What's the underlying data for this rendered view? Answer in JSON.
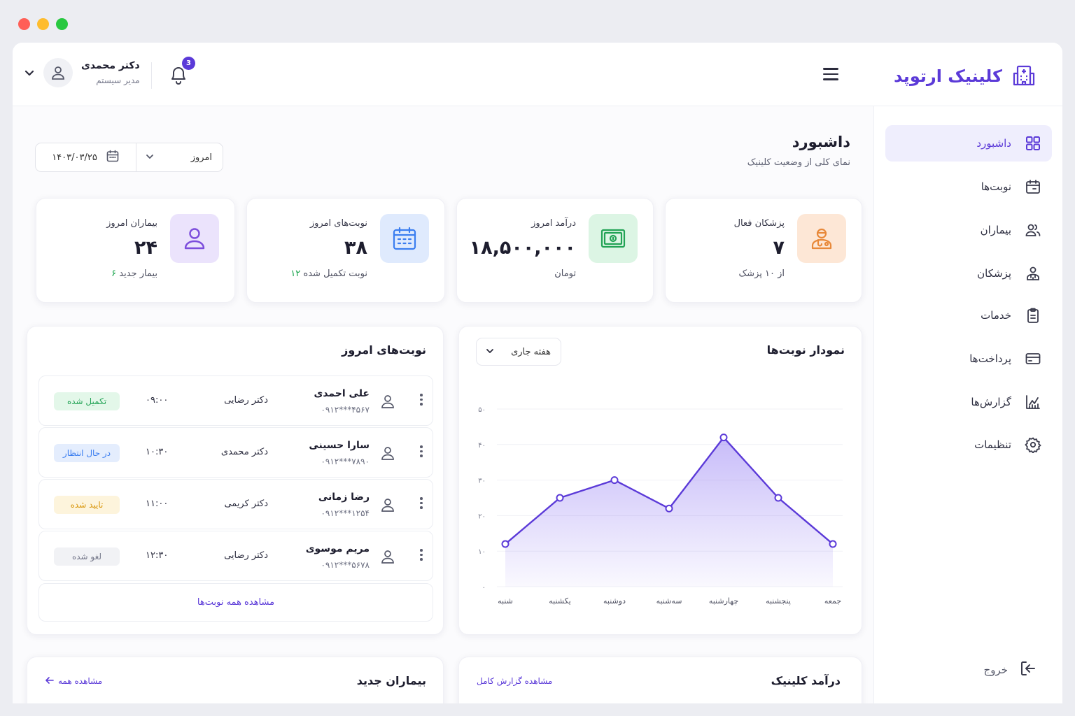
{
  "window": {
    "dot_colors": [
      "#ff5f57",
      "#febc2e",
      "#28c840"
    ]
  },
  "brand": {
    "name": "کلینیک ارتوپد",
    "color": "#5b3ad8"
  },
  "header": {
    "notification_count": "3",
    "user_name": "دکتر محمدی",
    "user_role": "مدیر سیستم"
  },
  "sidebar": {
    "items": [
      {
        "label": "داشبورد",
        "icon": "dashboard-grid-icon",
        "active": true
      },
      {
        "label": "نوبت‌ها",
        "icon": "calendar-icon"
      },
      {
        "label": "بیماران",
        "icon": "users-icon"
      },
      {
        "label": "پزشکان",
        "icon": "doctors-icon"
      },
      {
        "label": "خدمات",
        "icon": "clipboard-icon"
      },
      {
        "label": "پرداخت‌ها",
        "icon": "credit-card-icon"
      },
      {
        "label": "گزارش‌ها",
        "icon": "chart-icon"
      },
      {
        "label": "تنظیمات",
        "icon": "gear-icon"
      }
    ],
    "logout": "خروج"
  },
  "page": {
    "title": "داشبورد",
    "subtitle": "نمای کلی از وضعیت کلینیک"
  },
  "filters": {
    "date": "۱۴۰۳/۰۳/۲۵",
    "period": "امروز"
  },
  "stats": [
    {
      "label": "پزشکان فعال",
      "value": "۷",
      "sub": "از ۱۰ پزشک",
      "icon": "doctor-icon",
      "bg": "#fde7d6",
      "fg": "#e8893a"
    },
    {
      "label": "درآمد امروز",
      "value": "۱۸,۵۰۰,۰۰۰",
      "sub": "تومان",
      "icon": "money-icon",
      "bg": "#dcf5e4",
      "fg": "#22a355"
    },
    {
      "label": "نوبت‌های امروز",
      "value": "۳۸",
      "sub": "نوبت تکمیل شده",
      "sub_highlight": "۱۲",
      "icon": "calendar-icon",
      "bg": "#dfeafd",
      "fg": "#3b7ef0"
    },
    {
      "label": "بیماران امروز",
      "value": "۲۴",
      "sub": "بیمار جدید",
      "sub_highlight": "۶",
      "icon": "user-icon",
      "bg": "#ebe3fc",
      "fg": "#7c4ddc"
    }
  ],
  "chart_card": {
    "title": "نمودار نوبت‌ها",
    "select": "هفته جاری"
  },
  "chart_data": {
    "type": "area",
    "categories": [
      "شنبه",
      "یکشنبه",
      "دوشنبه",
      "سه‌شنبه",
      "چهارشنبه",
      "پنجشنبه",
      "جمعه"
    ],
    "values": [
      12,
      25,
      30,
      22,
      42,
      25,
      12
    ],
    "ylim": [
      0,
      50
    ],
    "yticks": [
      "۰",
      "۱۰",
      "۲۰",
      "۳۰",
      "۴۰",
      "۵۰"
    ],
    "color": "#5b3ad8"
  },
  "appointments": {
    "title": "نوبت‌های امروز",
    "rows": [
      {
        "name": "علی احمدی",
        "phone": "۰۹۱۲***۴۵۶۷",
        "doctor": "دکتر رضایی",
        "time": "۰۹:۰۰",
        "status": "تکمیل شده",
        "status_bg": "#e3f7e9",
        "status_fg": "#22a355"
      },
      {
        "name": "سارا حسینی",
        "phone": "۰۹۱۲***۷۸۹۰",
        "doctor": "دکتر محمدی",
        "time": "۱۰:۳۰",
        "status": "در حال انتظار",
        "status_bg": "#e4edfd",
        "status_fg": "#3b7ef0"
      },
      {
        "name": "رضا زمانی",
        "phone": "۰۹۱۲***۱۲۵۴",
        "doctor": "دکتر کریمی",
        "time": "۱۱:۰۰",
        "status": "تایید شده",
        "status_bg": "#fdf4dc",
        "status_fg": "#d9970e"
      },
      {
        "name": "مریم موسوی",
        "phone": "۰۹۱۲***۵۶۷۸",
        "doctor": "دکتر رضایی",
        "time": "۱۲:۳۰",
        "status": "لغو شده",
        "status_bg": "#f1f2f5",
        "status_fg": "#777a8c"
      }
    ],
    "view_all": "مشاهده همه نوبت‌ها"
  },
  "revenue_card": {
    "title": "درآمد کلینیک",
    "link": "مشاهده گزارش کامل"
  },
  "patients_card": {
    "title": "بیماران جدید",
    "link": "مشاهده همه"
  }
}
